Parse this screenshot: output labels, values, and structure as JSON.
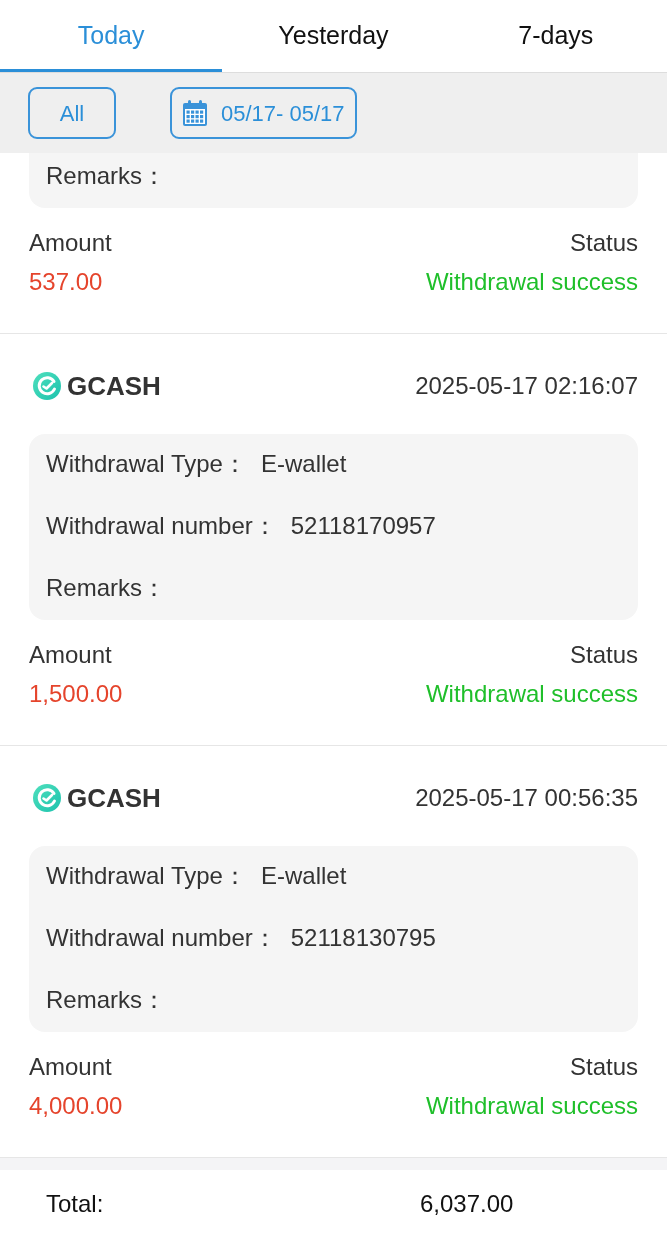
{
  "tabs": [
    {
      "label": "Today",
      "selected": true
    },
    {
      "label": "Yesterday",
      "selected": false
    },
    {
      "label": "7-days",
      "selected": false
    }
  ],
  "filters": {
    "all_button": "All",
    "date_range": "05/17- 05/17"
  },
  "records": [
    {
      "details": [
        {
          "label": "Remarks："
        }
      ],
      "amount_label": "Amount",
      "amount": "537.00",
      "status_label": "Status",
      "status": "Withdrawal success"
    },
    {
      "method": "GCASH",
      "time": "2025-05-17 02:16:07",
      "details": [
        {
          "label": "Withdrawal Type：",
          "value": "E-wallet"
        },
        {
          "label": "Withdrawal number：",
          "value": "52118170957"
        },
        {
          "label": "Remarks："
        }
      ],
      "amount_label": "Amount",
      "amount": "1,500.00",
      "status_label": "Status",
      "status": "Withdrawal success"
    },
    {
      "method": "GCASH",
      "time": "2025-05-17 00:56:35",
      "details": [
        {
          "label": "Withdrawal Type：",
          "value": "E-wallet"
        },
        {
          "label": "Withdrawal number：",
          "value": "52118130795"
        },
        {
          "label": "Remarks："
        }
      ],
      "amount_label": "Amount",
      "amount": "4,000.00",
      "status_label": "Status",
      "status": "Withdrawal success"
    }
  ],
  "footer": {
    "label": "Total:",
    "value": "6,037.00"
  }
}
